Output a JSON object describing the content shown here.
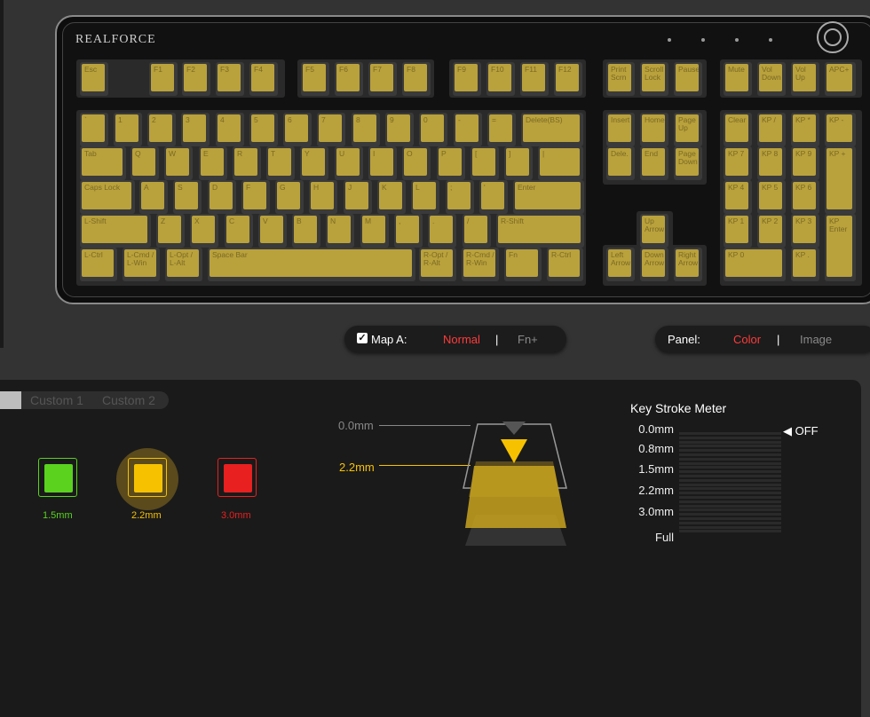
{
  "brand": "REALFORCE",
  "colors": {
    "keycap": "#b9a13c",
    "accent_red": "#ff3b3b",
    "green": "#5ad21e",
    "yellow": "#f6c200",
    "red": "#e82020"
  },
  "keyboard": {
    "row0": [
      "Esc",
      "F1",
      "F2",
      "F3",
      "F4",
      "F5",
      "F6",
      "F7",
      "F8",
      "F9",
      "F10",
      "F11",
      "F12",
      "Print Scrn",
      "Scroll Lock",
      "Pause",
      "Mute",
      "Vol Down",
      "Vol Up",
      "APC+"
    ],
    "row1": [
      "`",
      "1",
      "2",
      "3",
      "4",
      "5",
      "6",
      "7",
      "8",
      "9",
      "0",
      "-",
      "=",
      "Delete(BS)",
      "Insert",
      "Home",
      "Page Up",
      "Clear",
      "KP /",
      "KP *",
      "KP -"
    ],
    "row2": [
      "Tab",
      "Q",
      "W",
      "E",
      "R",
      "T",
      "Y",
      "U",
      "I",
      "O",
      "P",
      "[",
      "]",
      "|",
      "Dele.",
      "End",
      "Page Down",
      "KP 7",
      "KP 8",
      "KP 9",
      "KP +"
    ],
    "row3": [
      "Caps Lock",
      "A",
      "S",
      "D",
      "F",
      "G",
      "H",
      "J",
      "K",
      "L",
      ";",
      "'",
      "Enter",
      "KP 4",
      "KP 5",
      "KP 6"
    ],
    "row4": [
      "L-Shift",
      "Z",
      "X",
      "C",
      "V",
      "B",
      "N",
      "M",
      ",",
      ".",
      "/",
      "R-Shift",
      "Up Arrow",
      "KP 1",
      "KP 2",
      "KP 3",
      "KP Enter"
    ],
    "row5": [
      "L-Ctrl",
      "L-Cmd / L-Win",
      "L-Opt / L-Alt",
      "Space Bar",
      "R-Opt / R-Alt",
      "R-Cmd / R-Win",
      "Fn",
      "R-Ctrl",
      "Left Arrow",
      "Down Arrow",
      "Right Arrow",
      "KP 0",
      "KP ."
    ]
  },
  "map_toggle": {
    "label": "Map A:",
    "checked": true,
    "option_normal": "Normal",
    "separator": "|",
    "option_fn": "Fn+"
  },
  "panel_toggle": {
    "label": "Panel:",
    "option_color": "Color",
    "separator": "|",
    "option_image": "Image"
  },
  "tabs": [
    "Custom 1",
    "Custom 2"
  ],
  "swatches": [
    {
      "label": "1.5mm",
      "color": "#5ad21e",
      "selected": false
    },
    {
      "label": "2.2mm",
      "color": "#f6c200",
      "selected": true
    },
    {
      "label": "3.0mm",
      "color": "#e82020",
      "selected": false
    }
  ],
  "diagram": {
    "top_label": "0.0mm",
    "active_label": "2.2mm"
  },
  "meter": {
    "title": "Key Stroke Meter",
    "levels": [
      "0.0mm",
      "0.8mm",
      "1.5mm",
      "2.2mm",
      "3.0mm",
      "Full"
    ],
    "indicator": "◀ OFF"
  }
}
